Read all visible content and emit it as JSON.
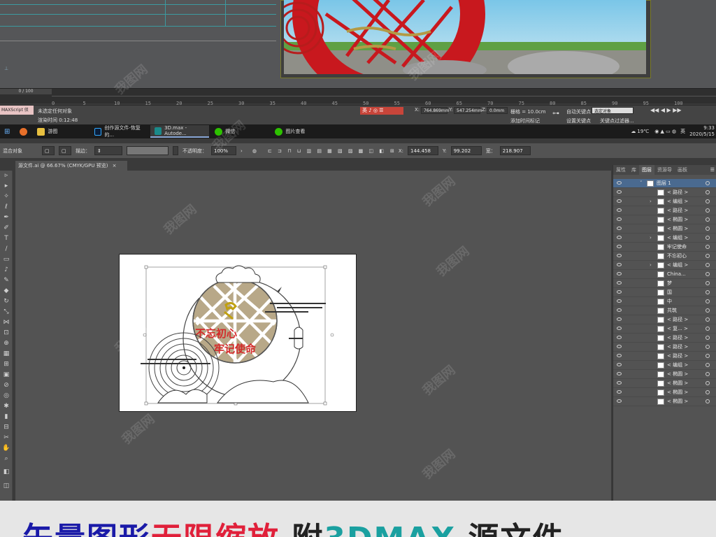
{
  "max_app": {
    "frame_counter": "0 / 100",
    "timeline_ticks": [
      "0",
      "5",
      "10",
      "15",
      "20",
      "25",
      "30",
      "35",
      "40",
      "45",
      "50",
      "55",
      "60",
      "65",
      "70",
      "75",
      "80",
      "85",
      "90",
      "95",
      "100"
    ],
    "maxscript_label": "MAXScript 侦",
    "status_line1": "未选定任何对象",
    "status_line2": "渲染时间 0:12:48",
    "x_coord": "764.869mm",
    "y_coord": "547.254mm",
    "z_coord": "0.0mm",
    "grid_label": "栅格 = 10.0cm",
    "add_time_tag": "添加时间标记",
    "auto_key": "自动关键点",
    "set_key": "设置关键点",
    "selection_dropdown": "选定对象",
    "key_filter": "关键点过滤器..."
  },
  "taskbar": {
    "items": [
      {
        "label": "",
        "icon": "windows-icon"
      },
      {
        "label": "",
        "icon": "firefox-icon"
      },
      {
        "label": "游图",
        "icon": "folder-icon"
      },
      {
        "label": "创作源文件-恢复的...",
        "icon": "photoshop-icon"
      },
      {
        "label": "3D.max - Autode...",
        "icon": "3dsmax-icon"
      },
      {
        "label": "微信",
        "icon": "wechat-icon"
      },
      {
        "label": "图片查看",
        "icon": "photos-icon"
      }
    ],
    "weather": "19℃",
    "ime_label": "英",
    "time": "9:33",
    "date": "2020/5/15"
  },
  "ime_bar": {
    "label": "英"
  },
  "ai_control_bar": {
    "mode": "混合对象",
    "stroke_label": "描边：",
    "opacity_label": "不透明度：",
    "opacity_value": "100%",
    "x_value": "144.458",
    "y_value": "99.202",
    "w_label": "宽：",
    "w_value": "218.907"
  },
  "ai_doc_tab": "源文件.ai @ 66.67% (CMYK/GPU 预览)",
  "artwork_text": {
    "line1": "不忘初心",
    "line2": "牢记使命"
  },
  "layers_panel": {
    "tabs": [
      "属性",
      "库",
      "图层",
      "资源导",
      "画板"
    ],
    "active_tab": "图层",
    "layers": [
      {
        "name": "图层 1",
        "expander": "˅",
        "indent": false
      },
      {
        "name": "< 路径 >",
        "expander": "",
        "indent": true
      },
      {
        "name": "< 编组 >",
        "expander": "›",
        "indent": true
      },
      {
        "name": "< 路径 >",
        "expander": "",
        "indent": true
      },
      {
        "name": "< 椭圆 >",
        "expander": "",
        "indent": true
      },
      {
        "name": "< 椭圆 >",
        "expander": "",
        "indent": true
      },
      {
        "name": "< 编组 >",
        "expander": "›",
        "indent": true
      },
      {
        "name": "牢记使命",
        "expander": "",
        "indent": true
      },
      {
        "name": "不忘初心",
        "expander": "",
        "indent": true
      },
      {
        "name": "< 编组 >",
        "expander": "›",
        "indent": true
      },
      {
        "name": "China...",
        "expander": "",
        "indent": true
      },
      {
        "name": "梦",
        "expander": "",
        "indent": true
      },
      {
        "name": "国",
        "expander": "",
        "indent": true
      },
      {
        "name": "中",
        "expander": "",
        "indent": true
      },
      {
        "name": "共筑",
        "expander": "",
        "indent": true
      },
      {
        "name": "< 路径 >",
        "expander": "",
        "indent": true
      },
      {
        "name": "< 复... >",
        "expander": "",
        "indent": true
      },
      {
        "name": "< 路径 >",
        "expander": "",
        "indent": true
      },
      {
        "name": "< 路径 >",
        "expander": "",
        "indent": true
      },
      {
        "name": "< 路径 >",
        "expander": "",
        "indent": true
      },
      {
        "name": "< 编组 >",
        "expander": "",
        "indent": true
      },
      {
        "name": "< 椭圆 >",
        "expander": "",
        "indent": true
      },
      {
        "name": "< 椭圆 >",
        "expander": "",
        "indent": true
      },
      {
        "name": "< 椭圆 >",
        "expander": "",
        "indent": true
      },
      {
        "name": "< 椭圆 >",
        "expander": "",
        "indent": true
      }
    ]
  },
  "banner": {
    "segments": [
      {
        "text": "矢量图形",
        "color": "#1a1aa8"
      },
      {
        "text": "无限缩放",
        "color": "#e0203a"
      },
      {
        "text": " 附",
        "color": "#222222"
      },
      {
        "text": "3DMAX",
        "color": "#1aa0a0"
      },
      {
        "text": " 源文件",
        "color": "#222222"
      }
    ]
  },
  "watermark_text": "我图网",
  "colors": {
    "accent_blue": "#8aa8d8",
    "gold": "#8a7a55",
    "red": "#c8181e"
  }
}
